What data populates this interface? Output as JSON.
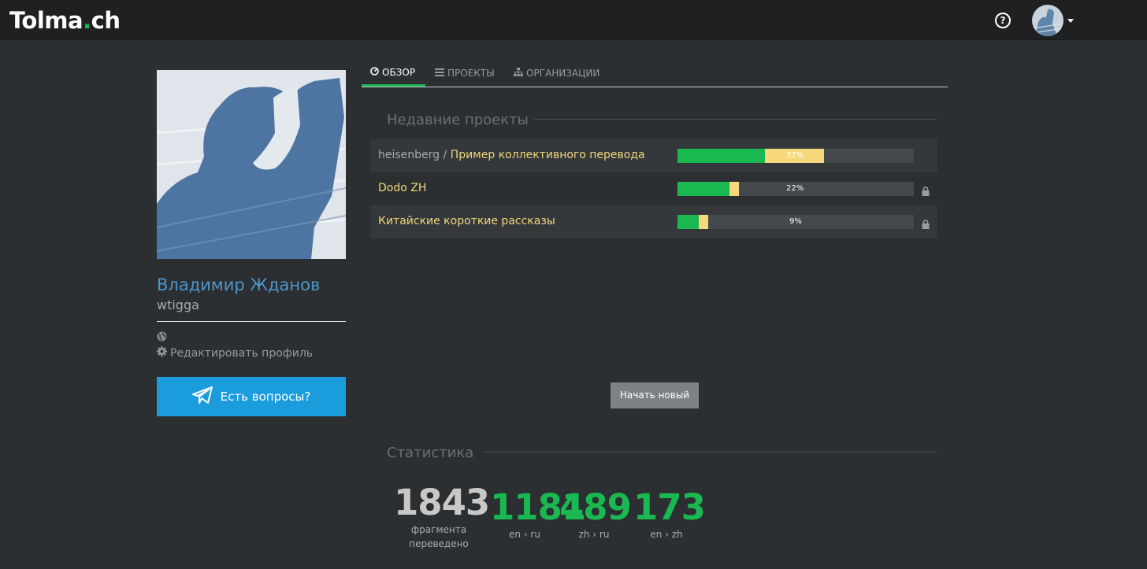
{
  "header": {
    "logo_main": "Tolma",
    "logo_dot": ".",
    "logo_tld": "ch",
    "help_icon": "question-circle-icon",
    "help_glyph": "?"
  },
  "profile": {
    "name": "Владимир Жданов",
    "login": "wtigga",
    "edit_label": "Редактировать профиль",
    "telegram_label": "Есть вопросы?"
  },
  "tabs": [
    {
      "label": "ОБЗОР",
      "icon": "dashboard-icon",
      "active": true
    },
    {
      "label": "ПРОЕКТЫ",
      "icon": "list-icon",
      "active": false
    },
    {
      "label": "ОРГАНИЗАЦИИ",
      "icon": "sitemap-icon",
      "active": false
    }
  ],
  "recent": {
    "title": "Недавние проекты",
    "projects": [
      {
        "owner": "heisenberg / ",
        "name": "Пример коллективного перевода",
        "green": 0.37,
        "yellow": 0.25,
        "label": "37%",
        "locked": false
      },
      {
        "owner": "",
        "name": "Dodo ZH",
        "green": 0.22,
        "yellow": 0.04,
        "label": "22%",
        "locked": true
      },
      {
        "owner": "",
        "name": "Китайские короткие рассказы",
        "green": 0.09,
        "yellow": 0.04,
        "label": "9%",
        "locked": true
      }
    ],
    "new_button": "Начать новый"
  },
  "stats": {
    "title": "Статистика",
    "items": [
      {
        "value": "1843",
        "label1": "фрагмента",
        "label2": "переведено",
        "color": "#c8c8c8"
      },
      {
        "value": "1181",
        "label1": "en › ru",
        "label2": "",
        "color": "#19b851"
      },
      {
        "value": "489",
        "label1": "zh › ru",
        "label2": "",
        "color": "#19b851"
      },
      {
        "value": "173",
        "label1": "en › zh",
        "label2": "",
        "color": "#19b851"
      }
    ]
  },
  "colors": {
    "accent": "#19b851",
    "name_blue": "#4e95c8",
    "project_yellow": "#f1d67b",
    "telegram_blue": "#1b9ddd"
  }
}
